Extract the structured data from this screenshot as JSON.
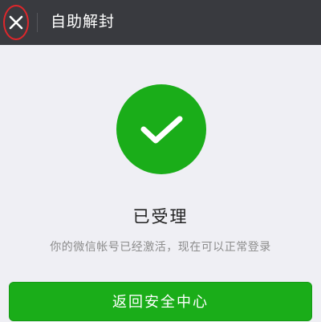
{
  "header": {
    "title": "自助解封",
    "close_icon": "close-icon"
  },
  "status": {
    "icon": "checkmark-icon",
    "title": "已受理",
    "description": "你的微信帐号已经激活，现在可以正常登录"
  },
  "actions": {
    "primary_label": "返回安全中心"
  },
  "colors": {
    "header_bg": "#393a3f",
    "page_bg": "#efeff4",
    "accent": "#1aad19",
    "highlight_ring": "#e0262b"
  }
}
